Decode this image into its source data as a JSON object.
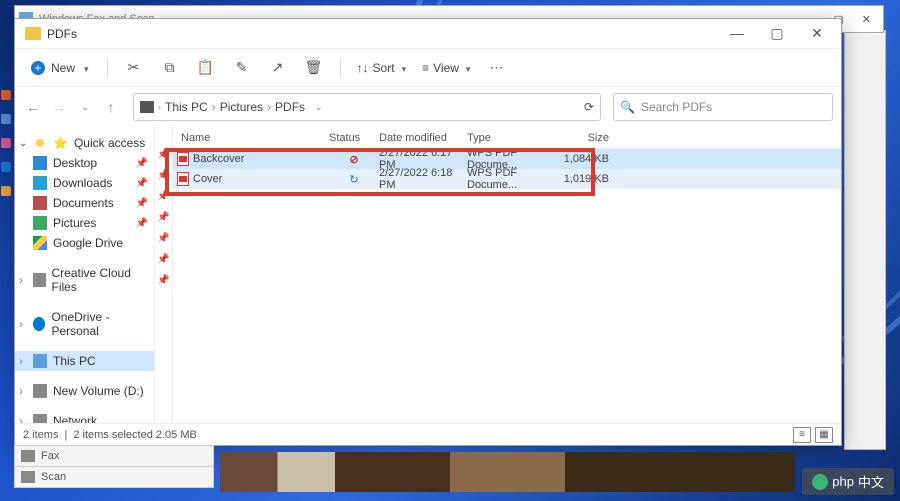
{
  "background_app": {
    "title": "Windows Fax and Scan",
    "side_items": [
      "Fax",
      "Scan"
    ]
  },
  "explorer": {
    "title": "PDFs",
    "toolbar": {
      "new_label": "New",
      "sort_label": "Sort",
      "view_label": "View",
      "icons": [
        "cut-icon",
        "copy-icon",
        "paste-icon",
        "rename-icon",
        "share-icon",
        "delete-icon"
      ]
    },
    "nav": {
      "crumbs": [
        "This PC",
        "Pictures",
        "PDFs"
      ],
      "search_placeholder": "Search PDFs"
    },
    "sidebar": {
      "quick_access": "Quick access",
      "items": [
        {
          "label": "Desktop",
          "cls": "desk"
        },
        {
          "label": "Downloads",
          "cls": "dl"
        },
        {
          "label": "Documents",
          "cls": "doc"
        },
        {
          "label": "Pictures",
          "cls": "pic"
        },
        {
          "label": "Google Drive",
          "cls": "gd"
        }
      ],
      "groups": [
        {
          "label": "Creative Cloud Files",
          "cls": "cc"
        },
        {
          "label": "OneDrive - Personal",
          "cls": "od"
        },
        {
          "label": "This PC",
          "cls": "pc",
          "selected": true
        },
        {
          "label": "New Volume (D:)",
          "cls": "nv"
        },
        {
          "label": "Network",
          "cls": "net"
        }
      ]
    },
    "columns": {
      "name": "Name",
      "status": "Status",
      "date": "Date modified",
      "type": "Type",
      "size": "Size"
    },
    "files": [
      {
        "name": "Backcover",
        "status": "error",
        "date": "2/27/2022 6:17 PM",
        "type": "WPS PDF Docume...",
        "size": "1,084 KB"
      },
      {
        "name": "Cover",
        "status": "sync",
        "date": "2/27/2022 6:18 PM",
        "type": "WPS PDF Docume...",
        "size": "1,019 KB"
      }
    ],
    "statusbar": {
      "count": "2 items",
      "selection": "2 items selected  2.05 MB"
    }
  },
  "watermark": "中文"
}
